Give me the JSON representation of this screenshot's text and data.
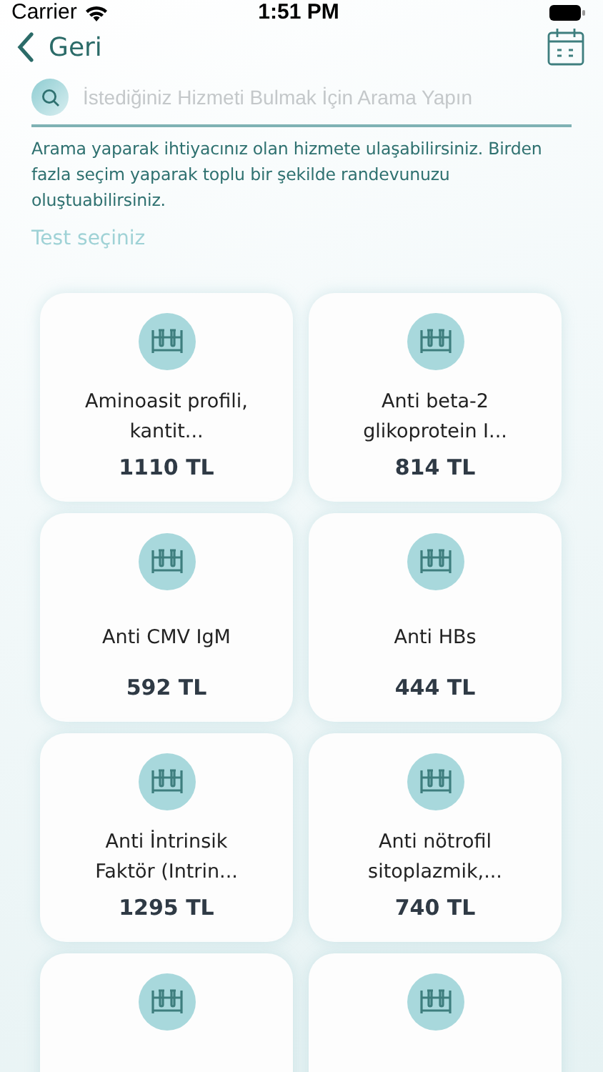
{
  "status_bar": {
    "carrier": "Carrier",
    "time": "1:51 PM"
  },
  "header": {
    "back_label": "Geri"
  },
  "search": {
    "placeholder": "İstediğiniz Hizmeti Bulmak İçin Arama Yapın"
  },
  "description": "Arama yaparak ihtiyacınız olan hizmete ulaşabilirsiniz. Birden fazla seçim yaparak toplu bir şekilde randevunuzu oluştuabilirsiniz.",
  "section_label": "Test seçiniz",
  "tests": [
    {
      "kind": "full",
      "name": "Aminoasit profili, kantit...",
      "price": "1110 TL"
    },
    {
      "kind": "full",
      "name": "Anti beta-2 glikoprotein I...",
      "price": "814 TL"
    },
    {
      "kind": "full",
      "name": "Anti CMV IgM",
      "price": "592 TL"
    },
    {
      "kind": "full",
      "name": "Anti HBs",
      "price": "444 TL"
    },
    {
      "kind": "full",
      "name": "Anti İntrinsik Faktör (Intrin...",
      "price": "1295 TL"
    },
    {
      "kind": "full",
      "name": "Anti nötrofil sitoplazmik,...",
      "price": "740 TL"
    },
    {
      "kind": "partial"
    },
    {
      "kind": "partial"
    }
  ]
}
